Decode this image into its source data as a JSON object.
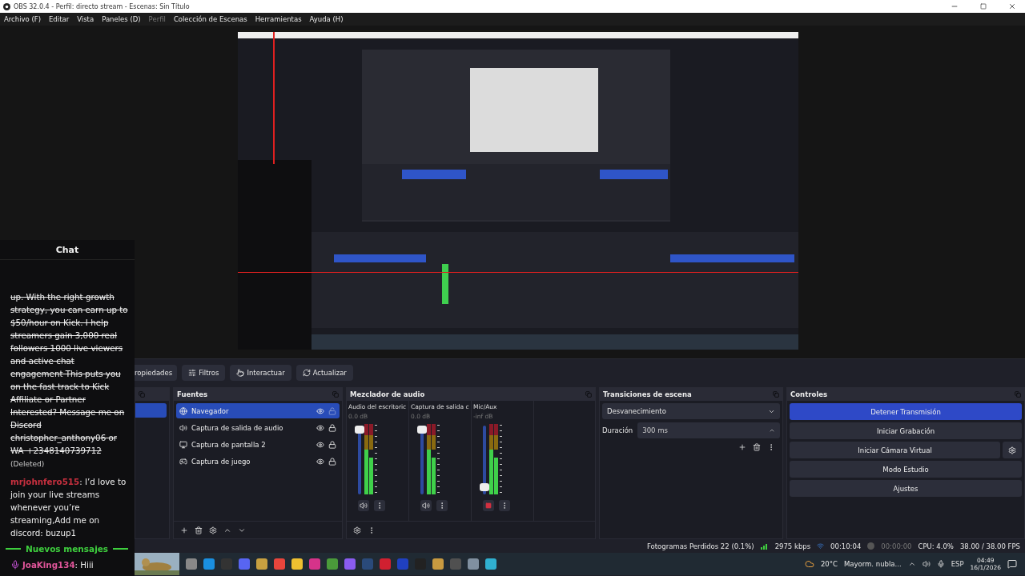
{
  "window": {
    "title": "OBS 32.0.4 - Perfil: directo stream - Escenas: Sin Título"
  },
  "menu": [
    {
      "label": "Archivo (F)",
      "disabled": false
    },
    {
      "label": "Editar",
      "disabled": false
    },
    {
      "label": "Vista",
      "disabled": false
    },
    {
      "label": "Paneles (D)",
      "disabled": false
    },
    {
      "label": "Perfil",
      "disabled": true
    },
    {
      "label": "Colección de Escenas",
      "disabled": false
    },
    {
      "label": "Herramientas",
      "disabled": false
    },
    {
      "label": "Ayuda (H)",
      "disabled": false
    }
  ],
  "chat": {
    "title": "Chat",
    "messages": [
      {
        "kind": "deleted",
        "text": "up. With the right growth strategy, you can earn up to $50/hour on Kick. I help streamers gain 3,000 real followers 1000 live viewers and active chat engagement This puts you on the fast track to Kick Affiliate or Partner Interested? Message me on Discord christopher_anthony06 or WA +2348140739712",
        "note": "(Deleted)"
      },
      {
        "kind": "message",
        "user": "mrjohnfero515",
        "color": "#c8303f",
        "text": ": I’d love to join your live streams whenever you’re streaming,Add me on discord: buzup1"
      },
      {
        "kind": "divider",
        "text": "Nuevos mensajes"
      },
      {
        "kind": "message",
        "user": "JoaKing134",
        "color": "#e0559a",
        "badge": true,
        "text": ": Hiii"
      }
    ]
  },
  "toolbar": [
    {
      "kind": "properties",
      "label": "ropiedades"
    },
    {
      "kind": "filters",
      "label": "Filtros"
    },
    {
      "kind": "interact",
      "label": "Interactuar"
    },
    {
      "kind": "refresh",
      "label": "Actualizar"
    }
  ],
  "scenes": [
    {
      "selected": true
    }
  ],
  "sources": {
    "title": "Fuentes",
    "items": [
      {
        "kind": "browser",
        "name": "Navegador",
        "selected": true,
        "visible": true,
        "locked": false
      },
      {
        "kind": "audio",
        "name": "Captura de salida de audio",
        "selected": false,
        "visible": true,
        "locked": true
      },
      {
        "kind": "display",
        "name": "Captura de pantalla 2",
        "selected": false,
        "visible": true,
        "locked": true
      },
      {
        "kind": "game",
        "name": "Captura de juego",
        "selected": false,
        "visible": true,
        "locked": true
      }
    ]
  },
  "mixer": {
    "title": "Mezclador de audio",
    "channels": [
      {
        "name": "Audio del escritoric",
        "reading": "0.0 dB",
        "level": 1,
        "muted": false
      },
      {
        "name": "Captura de salida c",
        "reading": "0.0 dB",
        "level": 1,
        "muted": false
      },
      {
        "name": "Mic/Aux",
        "reading": "-inf dB",
        "level": 0.05,
        "muted": true
      }
    ]
  },
  "transitions": {
    "title": "Transiciones de escena",
    "selected": "Desvanecimiento",
    "duration_label": "Duración",
    "duration": "300 ms"
  },
  "controls": {
    "title": "Controles",
    "buttons": [
      {
        "label": "Detener Transmisión",
        "active": true,
        "gear": false
      },
      {
        "label": "Iniciar Grabación",
        "active": false,
        "gear": false
      },
      {
        "label": "Iniciar Cámara Virtual",
        "active": false,
        "gear": true
      },
      {
        "label": "Modo Estudio",
        "active": false,
        "gear": false
      },
      {
        "label": "Ajustes",
        "active": false,
        "gear": false
      }
    ]
  },
  "status_bar": {
    "dropped": "Fotogramas Perdidos 22 (0.1%)",
    "bitrate": "2975 kbps",
    "stream_time": "00:10:04",
    "record_time": "00:00:00",
    "cpu": "CPU: 4.0%",
    "fps": "38.00 / 38.00 FPS"
  },
  "taskbar": {
    "apps": [
      {
        "color": "#888888"
      },
      {
        "color": "#1a8fe0"
      },
      {
        "color": "#333333"
      },
      {
        "color": "#5865f2"
      },
      {
        "color": "#c8a040"
      },
      {
        "color": "#e8453c"
      },
      {
        "color": "#f0c030"
      },
      {
        "color": "#d6338a"
      },
      {
        "color": "#4a9a3a"
      },
      {
        "color": "#8a5cf0"
      },
      {
        "color": "#2a4a7a"
      },
      {
        "color": "#d02030"
      },
      {
        "color": "#2040c0"
      },
      {
        "color": "#222222"
      },
      {
        "color": "#c89a40"
      },
      {
        "color": "#505050"
      },
      {
        "color": "#8090a0"
      },
      {
        "color": "#30b0d0"
      }
    ],
    "weather": "20°C",
    "forecast": "Mayorm. nubla...",
    "language": "ESP",
    "time": "04:49",
    "date": "16/1/2026"
  }
}
